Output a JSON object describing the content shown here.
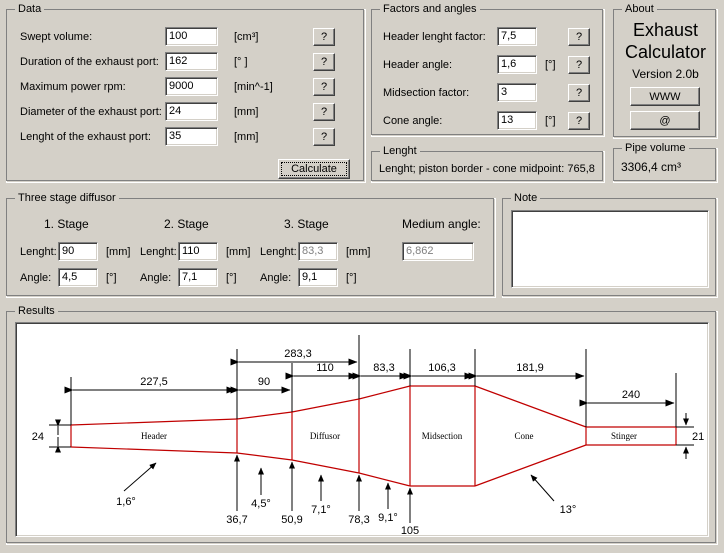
{
  "data_group": {
    "title": "Data",
    "rows": [
      {
        "label": "Swept volume:",
        "value": "100",
        "unit": "[cm³]",
        "help": "?"
      },
      {
        "label": "Duration of the exhaust port:",
        "value": "162",
        "unit": "[° ]",
        "help": "?"
      },
      {
        "label": "Maximum power rpm:",
        "value": "9000",
        "unit": "[min^-1]",
        "help": "?"
      },
      {
        "label": "Diameter of the exhaust port:",
        "value": "24",
        "unit": "[mm]",
        "help": "?"
      },
      {
        "label": "Lenght of the exhaust port:",
        "value": "35",
        "unit": "[mm]",
        "help": "?"
      }
    ],
    "calculate_label": "Calculate"
  },
  "factors_group": {
    "title": "Factors and angles",
    "rows": [
      {
        "label": "Header lenght factor:",
        "value": "7,5",
        "unit": "",
        "help": "?"
      },
      {
        "label": "Header angle:",
        "value": "1,6",
        "unit": "[°]",
        "help": "?"
      },
      {
        "label": "Midsection factor:",
        "value": "3",
        "unit": "",
        "help": "?"
      },
      {
        "label": "Cone angle:",
        "value": "13",
        "unit": "[°]",
        "help": "?"
      }
    ]
  },
  "lenght_group": {
    "title": "Lenght",
    "text": "Lenght; piston border - cone midpoint:   765,8"
  },
  "about_group": {
    "title": "About",
    "name_line1": "Exhaust",
    "name_line2": "Calculator",
    "version": "Version 2.0b",
    "www_label": "WWW",
    "mail_label": "@"
  },
  "pipe_volume_group": {
    "title": "Pipe volume",
    "value": "3306,4 cm³"
  },
  "diffusor_group": {
    "title": "Three stage diffusor",
    "stage_headers": [
      "1. Stage",
      "2. Stage",
      "3. Stage"
    ],
    "medium_angle_label": "Medium angle:",
    "medium_angle_value": "6,862",
    "lenght_label": "Lenght:",
    "angle_label": "Angle:",
    "unit_mm": "[mm]",
    "unit_deg": "[°]",
    "stages": [
      {
        "lenght": "90",
        "angle": "4,5",
        "disabled": false
      },
      {
        "lenght": "110",
        "angle": "7,1",
        "disabled": false
      },
      {
        "lenght": "83,3",
        "angle": "9,1",
        "disabled": true
      }
    ]
  },
  "note_group": {
    "title": "Note",
    "value": ""
  },
  "results_group": {
    "title": "Results",
    "diagram": {
      "section_labels": [
        "Header",
        "Diffusor",
        "Midsection",
        "Cone",
        "Stinger"
      ],
      "top_dimensions": [
        "227,5",
        "90",
        "110",
        "283,3",
        "83,3",
        "106,3",
        "181,9",
        "240"
      ],
      "left_diameter": "24",
      "right_diameter": "21",
      "bottom_diameters": [
        "36,7",
        "50,9",
        "78,3",
        "105"
      ],
      "angle_callouts": [
        "1,6°",
        "4,5°",
        "7,1°",
        "9,1°",
        "13°"
      ]
    }
  },
  "colors": {
    "face": "#d4d0c8",
    "pipe": "#c00000",
    "dim": "#000000",
    "field_bg": "#ffffff",
    "disabled_text": "#808080"
  }
}
